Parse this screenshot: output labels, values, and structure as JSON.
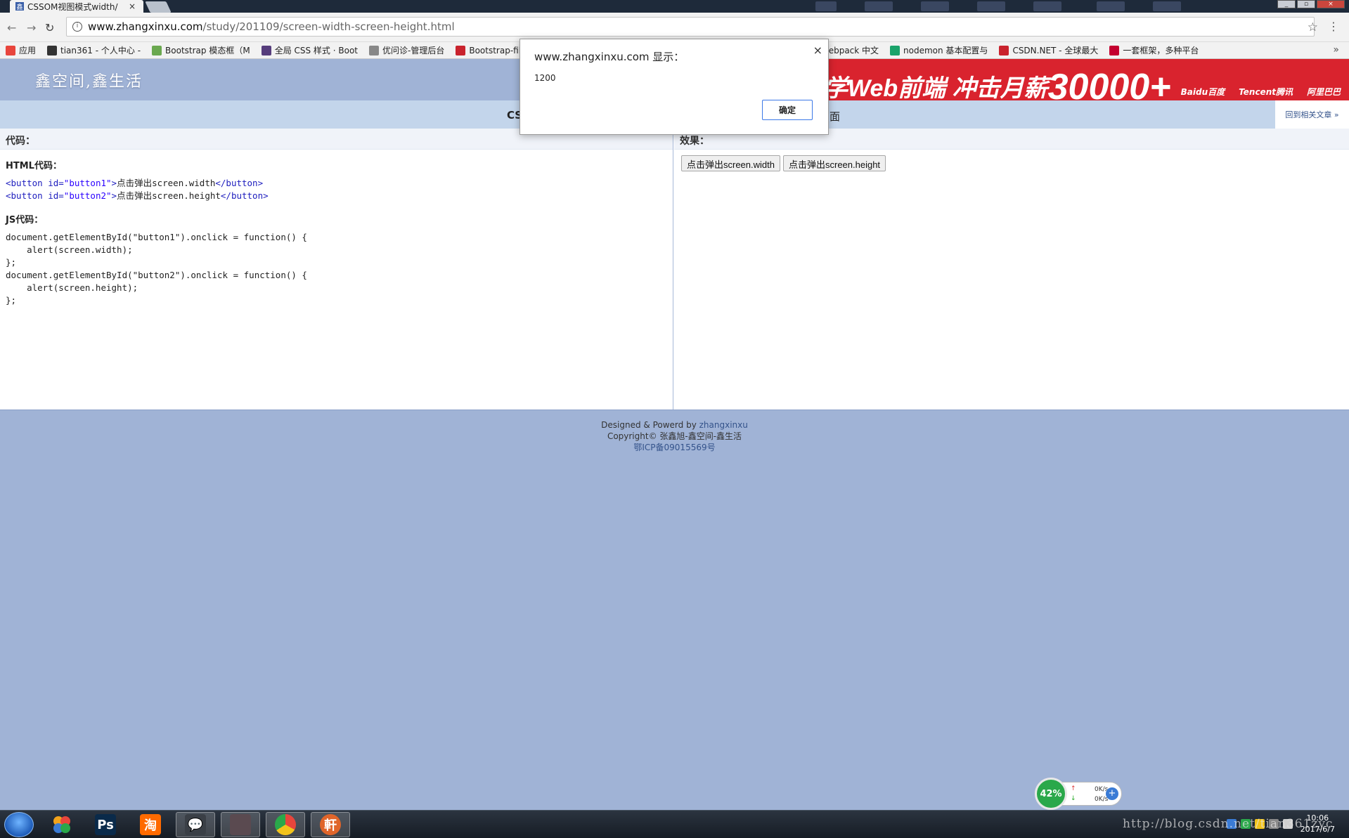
{
  "browser": {
    "tab_title": "CSSOM视图模式width/",
    "tab_close": "×",
    "url_host": "www.zhangxinxu.com",
    "url_path": "/study/201109/screen-width-screen-height.html",
    "back_glyph": "←",
    "forward_glyph": "→",
    "reload_glyph": "↻",
    "star_glyph": "☆",
    "menu_glyph": "⋮",
    "info_glyph": "i"
  },
  "bookmarks": [
    {
      "label": "应用",
      "icon": "apps-grid-icon",
      "color": "#e8453c"
    },
    {
      "label": "tian361 - 个人中心 -",
      "icon": "github-icon",
      "color": "#333333"
    },
    {
      "label": "Bootstrap 模态框（M",
      "icon": "runoob-icon",
      "color": "#6aa84f"
    },
    {
      "label": "全局 CSS 样式 · Boot",
      "icon": "bootstrap-icon",
      "color": "#563d7c"
    },
    {
      "label": "优问诊-管理后台",
      "icon": "page-icon",
      "color": "#888888"
    },
    {
      "label": "Bootstrap-file",
      "icon": "csdn-icon",
      "color": "#c9232d"
    },
    {
      "label": "开发 · webpack 中文",
      "icon": "webpack-icon",
      "color": "#4a90d9"
    },
    {
      "label": "nodemon 基本配置与",
      "icon": "segmentfault-icon",
      "color": "#1aa36a"
    },
    {
      "label": "CSDN.NET - 全球最大",
      "icon": "csdn-icon",
      "color": "#c9232d"
    },
    {
      "label": "一套框架，多种平台",
      "icon": "angular-icon",
      "color": "#c3002f"
    }
  ],
  "bookmarks_more": "»",
  "header": {
    "logo_text": "鑫空间,鑫生活",
    "ad_text": "学Web前端  冲击月薪",
    "ad_number": "30000+",
    "ad_brands": [
      "Baidu百度",
      "Tencent腾讯",
      "阿里巴巴"
    ]
  },
  "titlebar": {
    "title_left": "CS",
    "title_right": "面",
    "back_link": "回到相关文章 »"
  },
  "code_panel": {
    "heading": "代码：",
    "html_heading": "HTML代码：",
    "js_heading": "JS代码：",
    "html_lines": [
      {
        "open": "<button id=",
        "idval": "\"button1\"",
        "close": ">",
        "text": "点击弹出screen.width",
        "end": "</button>"
      },
      {
        "open": "<button id=",
        "idval": "\"button2\"",
        "close": ">",
        "text": "点击弹出screen.height",
        "end": "</button>"
      }
    ],
    "js_lines": [
      "document.getElementById(\"button1\").onclick = function() {",
      "    alert(screen.width);",
      "};",
      "document.getElementById(\"button2\").onclick = function() {",
      "    alert(screen.height);",
      "};"
    ]
  },
  "effect_panel": {
    "heading": "效果：",
    "button1_label": "点击弹出screen.width",
    "button2_label": "点击弹出screen.height"
  },
  "footer": {
    "line1_prefix": "Designed & Powerd by ",
    "line1_link": "zhangxinxu",
    "line2": "Copyright© 张鑫旭-鑫空间-鑫生活",
    "line3": "鄂ICP备09015569号"
  },
  "dialog": {
    "title": "www.zhangxinxu.com 显示：",
    "message": "1200",
    "ok_label": "确定",
    "close_glyph": "×"
  },
  "netwidget": {
    "percent": "42%",
    "up_rate": "0K/s",
    "down_rate": "0K/s",
    "up_glyph": "↑",
    "down_glyph": "↓",
    "plus_glyph": "+"
  },
  "taskbar": {
    "apps": [
      {
        "name": "photoshop",
        "label": "Ps",
        "color": "#0a2a4a"
      },
      {
        "name": "taobao",
        "label": "淘",
        "color": "#ff6a00"
      },
      {
        "name": "wechat",
        "label": "💬",
        "color": "#3a3f46"
      },
      {
        "name": "photo-app",
        "label": "",
        "color": "#5a4a50"
      },
      {
        "name": "chrome",
        "label": "",
        "color": "#3a3f46"
      },
      {
        "name": "xuanjiang",
        "label": "軒",
        "color": "#e0652a"
      }
    ],
    "watermark": "http://blog.csdn.net/tian361zyc",
    "clock_time": "10:06",
    "clock_date": "2017/6/7"
  }
}
